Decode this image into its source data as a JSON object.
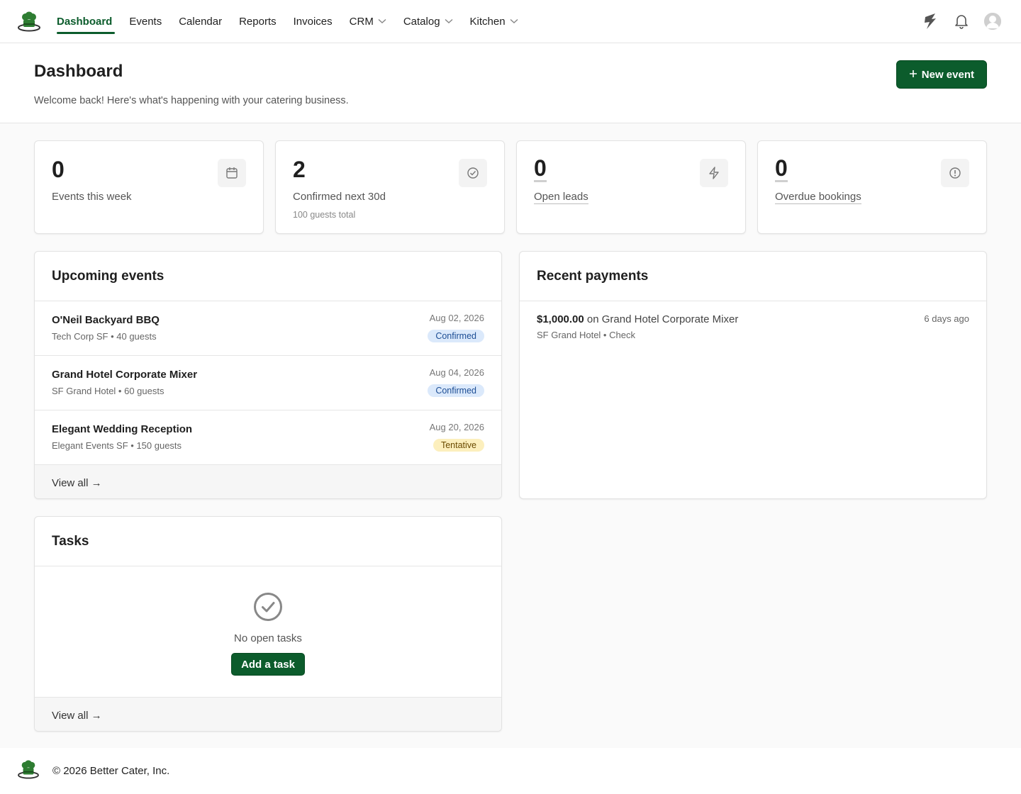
{
  "nav": {
    "items": [
      {
        "label": "Dashboard",
        "active": true
      },
      {
        "label": "Events"
      },
      {
        "label": "Calendar"
      },
      {
        "label": "Reports"
      },
      {
        "label": "Invoices"
      },
      {
        "label": "CRM",
        "dropdown": true
      },
      {
        "label": "Catalog",
        "dropdown": true
      },
      {
        "label": "Kitchen",
        "dropdown": true
      }
    ],
    "right_icons": [
      "feather-bolt-icon",
      "bell-icon",
      "avatar-icon"
    ]
  },
  "header": {
    "title": "Dashboard",
    "subtitle": "Welcome back! Here's what's happening with your catering business.",
    "new_event_label": "New event"
  },
  "stats": [
    {
      "value": "0",
      "label": "Events this week",
      "note": "",
      "icon": "calendar-icon"
    },
    {
      "value": "2",
      "label": "Confirmed next 30d",
      "note": "100 guests total",
      "icon": "check-circle-icon"
    },
    {
      "value": "0",
      "label": "Open leads",
      "note": "",
      "icon": "lightning-icon"
    },
    {
      "value": "0",
      "label": "Overdue bookings",
      "note": "",
      "icon": "alert-circle-icon"
    }
  ],
  "upcoming": {
    "title": "Upcoming events",
    "events": [
      {
        "name": "O'Neil Backyard BBQ",
        "meta": "Tech Corp SF • 40 guests",
        "date": "Aug 02, 2026",
        "status": "Confirmed"
      },
      {
        "name": "Grand Hotel Corporate Mixer",
        "meta": "SF Grand Hotel • 60 guests",
        "date": "Aug 04, 2026",
        "status": "Confirmed"
      },
      {
        "name": "Elegant Wedding Reception",
        "meta": "Elegant Events SF • 150 guests",
        "date": "Aug 20, 2026",
        "status": "Tentative"
      }
    ],
    "view_all": "View all →"
  },
  "payments": {
    "title": "Recent payments",
    "items": [
      {
        "amount": "$1,000.00",
        "on_text": " on Grand Hotel Corporate Mixer",
        "meta": "SF Grand Hotel • Check",
        "time": "6 days ago"
      }
    ]
  },
  "tasks": {
    "title": "Tasks",
    "empty_text": "No open tasks",
    "add_label": "Add a task",
    "view_all": "View all →"
  },
  "footer": {
    "text": "© 2026 Better Cater, Inc."
  },
  "colors": {
    "brand": "#0c5c2c",
    "confirmed_bg": "#dbe9fb",
    "tentative_bg": "#fcefbd"
  }
}
